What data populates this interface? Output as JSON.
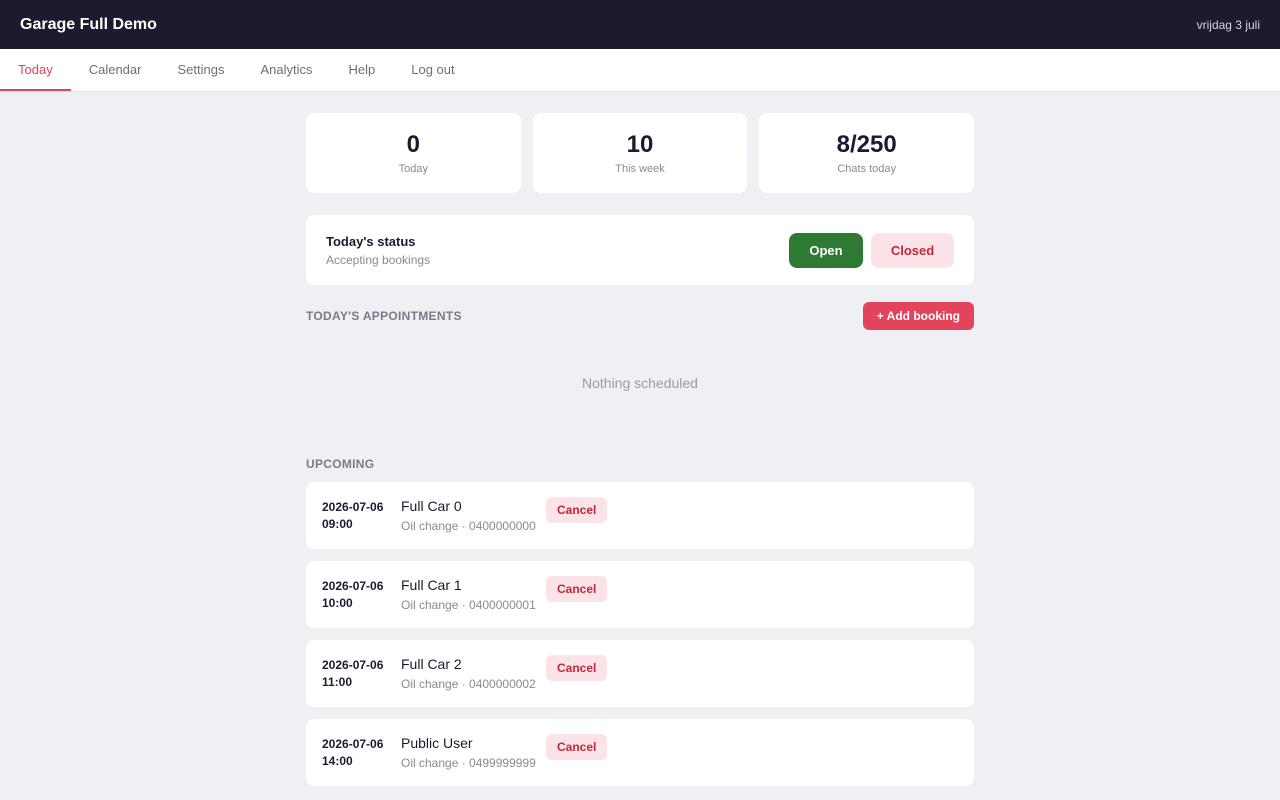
{
  "header": {
    "app_title": "Garage Full Demo",
    "date": "vrijdag 3 juli"
  },
  "nav": {
    "tabs": [
      {
        "label": "Today",
        "active": true
      },
      {
        "label": "Calendar",
        "active": false
      },
      {
        "label": "Settings",
        "active": false
      },
      {
        "label": "Analytics",
        "active": false
      },
      {
        "label": "Help",
        "active": false
      },
      {
        "label": "Log out",
        "active": false
      }
    ]
  },
  "stats": [
    {
      "value": "0",
      "label": "Today"
    },
    {
      "value": "10",
      "label": "This week"
    },
    {
      "value": "8/250",
      "label": "Chats today"
    }
  ],
  "status": {
    "title": "Today's status",
    "subtitle": "Accepting bookings",
    "open_label": "Open",
    "closed_label": "Closed"
  },
  "today": {
    "title": "TODAY'S APPOINTMENTS",
    "add_label": "+ Add booking",
    "empty_text": "Nothing scheduled"
  },
  "upcoming": {
    "title": "UPCOMING",
    "cancel_label": "Cancel",
    "items": [
      {
        "date": "2026-07-06",
        "time": "09:00",
        "name": "Full Car 0",
        "detail": "Oil change · 0400000000"
      },
      {
        "date": "2026-07-06",
        "time": "10:00",
        "name": "Full Car 1",
        "detail": "Oil change · 0400000001"
      },
      {
        "date": "2026-07-06",
        "time": "11:00",
        "name": "Full Car 2",
        "detail": "Oil change · 0400000002"
      },
      {
        "date": "2026-07-06",
        "time": "14:00",
        "name": "Public User",
        "detail": "Oil change · 0499999999"
      }
    ]
  },
  "colors": {
    "accent": "#e2445c",
    "topbar": "#1b1a2e",
    "open_green": "#2e7a32",
    "background": "#eff0f4"
  }
}
